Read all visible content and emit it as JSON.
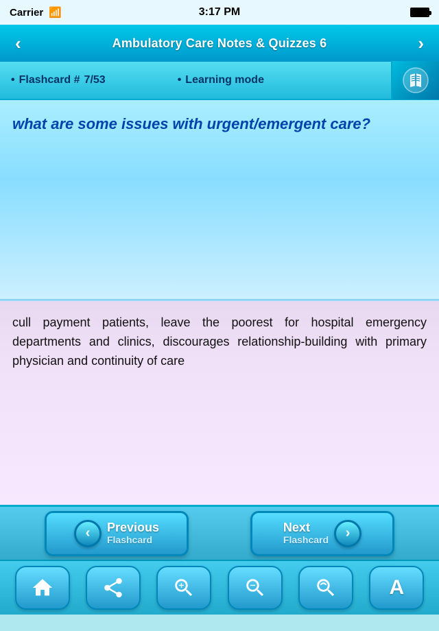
{
  "statusBar": {
    "carrier": "Carrier",
    "time": "3:17 PM"
  },
  "navBar": {
    "title": "Ambulatory Care Notes & Quizzes 6",
    "leftArrow": "‹",
    "rightArrow": "›"
  },
  "infoBar": {
    "flashcardLabel": "Flashcard #",
    "flashcardNum": "7/53",
    "dot1": "•",
    "dot2": "•",
    "learningMode": "Learning mode"
  },
  "question": {
    "text": "what are some issues with urgent/emergent care?"
  },
  "answer": {
    "text": "cull payment patients, leave the poorest for hospital emergency departments and clinics, discourages relationship-building with primary physician and continuity of care"
  },
  "bottomNav": {
    "prevLabel": "Previous",
    "prevSub": "Flashcard",
    "nextLabel": "Next",
    "nextSub": "Flashcard",
    "prevArrow": "‹",
    "nextArrow": "›"
  },
  "toolbar": {
    "home": "⌂",
    "share": "↗",
    "zoomIn": "⊕",
    "zoomOut": "⊖",
    "search": "🔍",
    "font": "A"
  },
  "colors": {
    "questionText": "#0044aa",
    "answerText": "#111111",
    "navBackground": "#0099cc",
    "accent": "#00ccee"
  }
}
